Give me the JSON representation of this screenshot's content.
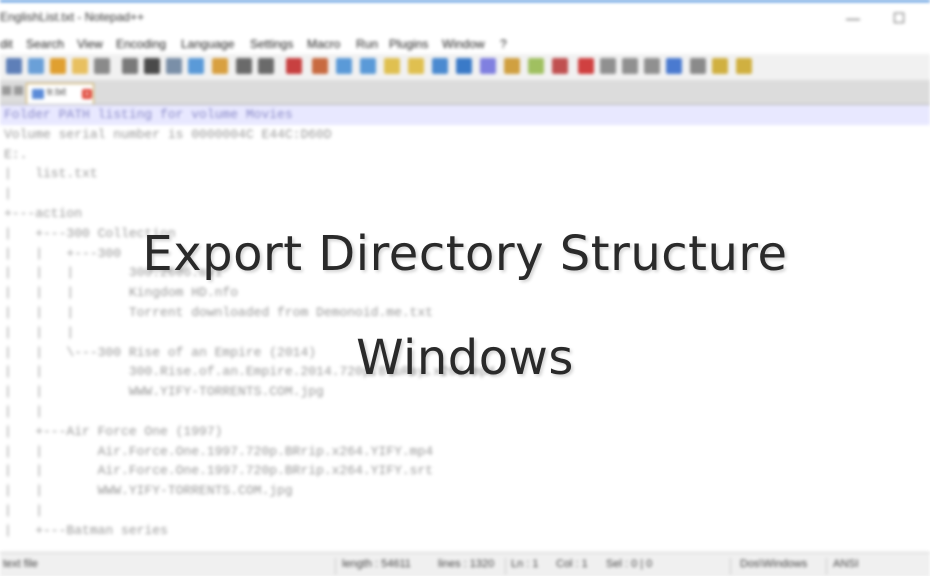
{
  "window": {
    "title": "EnglishList.txt - Notepad++",
    "minimize_glyph": "—",
    "maximize_glyph": "☐"
  },
  "menu": [
    "dit",
    "Search",
    "View",
    "Encoding",
    "Language",
    "Settings",
    "Macro",
    "Run",
    "Plugins",
    "Window",
    "?"
  ],
  "toolbar": {
    "icons": [
      "new-file-icon",
      "open-file-icon",
      "save-icon",
      "save-all-icon",
      "close-icon",
      "close-all-icon",
      "print-icon",
      "cut-icon",
      "copy-icon",
      "paste-icon",
      "undo-icon",
      "redo-icon",
      "find-icon",
      "replace-icon",
      "zoom-in-icon",
      "zoom-out-icon",
      "sync-v-icon",
      "sync-h-icon",
      "word-wrap-icon",
      "show-all-icon",
      "indent-guide-icon",
      "lang-icon",
      "doc-map-icon",
      "function-list-icon",
      "folder-icon",
      "monitor-icon",
      "record-icon",
      "stop-icon",
      "play-icon",
      "run-multiple-icon",
      "save-macro-icon",
      "spellcheck-icon"
    ]
  },
  "tab": {
    "label": "tr.txt",
    "close_glyph": "x"
  },
  "editor": {
    "lines": [
      "Folder PATH listing for volume Movies",
      "Volume serial number is 0000004C E44C:D60D",
      "E:.",
      "|   list.txt",
      "|",
      "+---action",
      "|   +---300 Collection",
      "|   |   +---300",
      "|   |   |       300.2006.avi",
      "|   |   |       Kingdom HD.nfo",
      "|   |   |       Torrent downloaded from Demonoid.me.txt",
      "|   |   |",
      "|   |   \\---300 Rise of an Empire (2014)",
      "|   |           300.Rise.of.an.Empire.2014.720p.BluRay.x264.mp4",
      "|   |           WWW.YIFY-TORRENTS.COM.jpg",
      "|   |",
      "|   +---Air Force One (1997)",
      "|   |       Air.Force.One.1997.720p.BRrip.x264.YIFY.mp4",
      "|   |       Air.Force.One.1997.720p.BRrip.x264.YIFY.srt",
      "|   |       WWW.YIFY-TORRENTS.COM.jpg",
      "|   |",
      "|   +---Batman series"
    ]
  },
  "statusbar": {
    "type": "text file",
    "length": "length : 54611",
    "lines": "lines : 1320",
    "ln": "Ln : 1",
    "col": "Col : 1",
    "sel": "Sel : 0 | 0",
    "eol": "Dos\\Windows",
    "encoding": "ANSI"
  },
  "overlay": {
    "line1": "Export Directory Structure",
    "line2": "Windows"
  },
  "colors": {
    "accent_top": "#2b7bd6",
    "current_line": "#e8e8ff",
    "tab_border": "#c9a24a",
    "tab_close": "#e04a3c"
  }
}
